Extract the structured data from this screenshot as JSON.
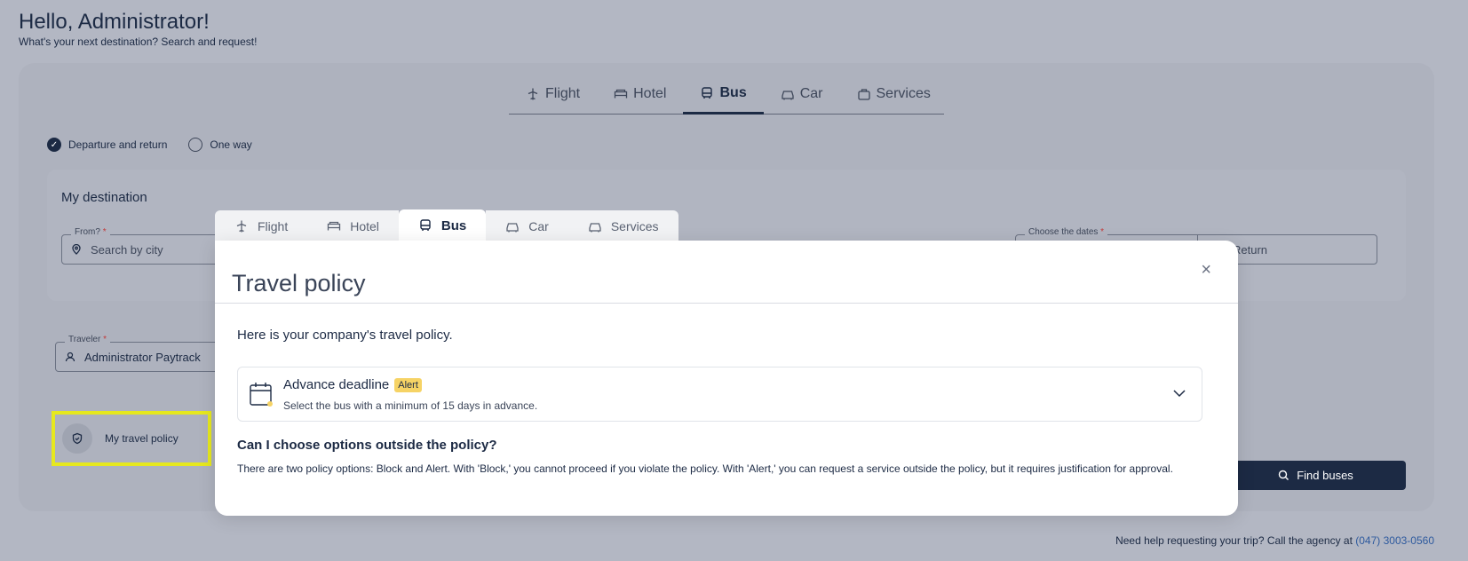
{
  "greeting": {
    "title": "Hello, Administrator!",
    "subtitle": "What's your next destination? Search and request!"
  },
  "top_tabs": [
    {
      "label": "Flight",
      "icon": "plane-icon"
    },
    {
      "label": "Hotel",
      "icon": "bed-icon"
    },
    {
      "label": "Bus",
      "icon": "bus-icon",
      "active": true
    },
    {
      "label": "Car",
      "icon": "car-icon"
    },
    {
      "label": "Services",
      "icon": "bag-icon"
    }
  ],
  "trip_type": {
    "roundtrip": "Departure and return",
    "oneway": "One way"
  },
  "destination": {
    "title": "My destination",
    "from_label": "From?",
    "from_placeholder": "Search by city",
    "dates_label": "Choose the dates",
    "return_placeholder": "Return"
  },
  "traveler": {
    "label": "Traveler",
    "value": "Administrator Paytrack"
  },
  "policy_button": "My travel policy",
  "find_button": "Find buses",
  "help": {
    "text": "Need help requesting your trip? Call the agency at",
    "phone": "(047) 3003-0560"
  },
  "modal": {
    "tabs": [
      {
        "label": "Flight",
        "icon": "plane-icon"
      },
      {
        "label": "Hotel",
        "icon": "bed-icon"
      },
      {
        "label": "Bus",
        "icon": "bus-icon",
        "active": true
      },
      {
        "label": "Car",
        "icon": "car-icon"
      },
      {
        "label": "Services",
        "icon": "car-icon"
      }
    ],
    "title": "Travel policy",
    "close": "×",
    "intro": "Here is your company's travel policy.",
    "rule": {
      "title": "Advance deadline",
      "badge": "Alert",
      "description": "Select the bus with a minimum of 15 days in advance."
    },
    "question": "Can I choose options outside the policy?",
    "answer": "There are two policy options: Block and Alert. With 'Block,' you cannot proceed if you violate the policy. With 'Alert,' you can request a service outside the policy, but it requires justification for approval."
  },
  "colors": {
    "primary": "#1c2a44",
    "highlight": "#e6e81e",
    "alert": "#f6d365"
  }
}
